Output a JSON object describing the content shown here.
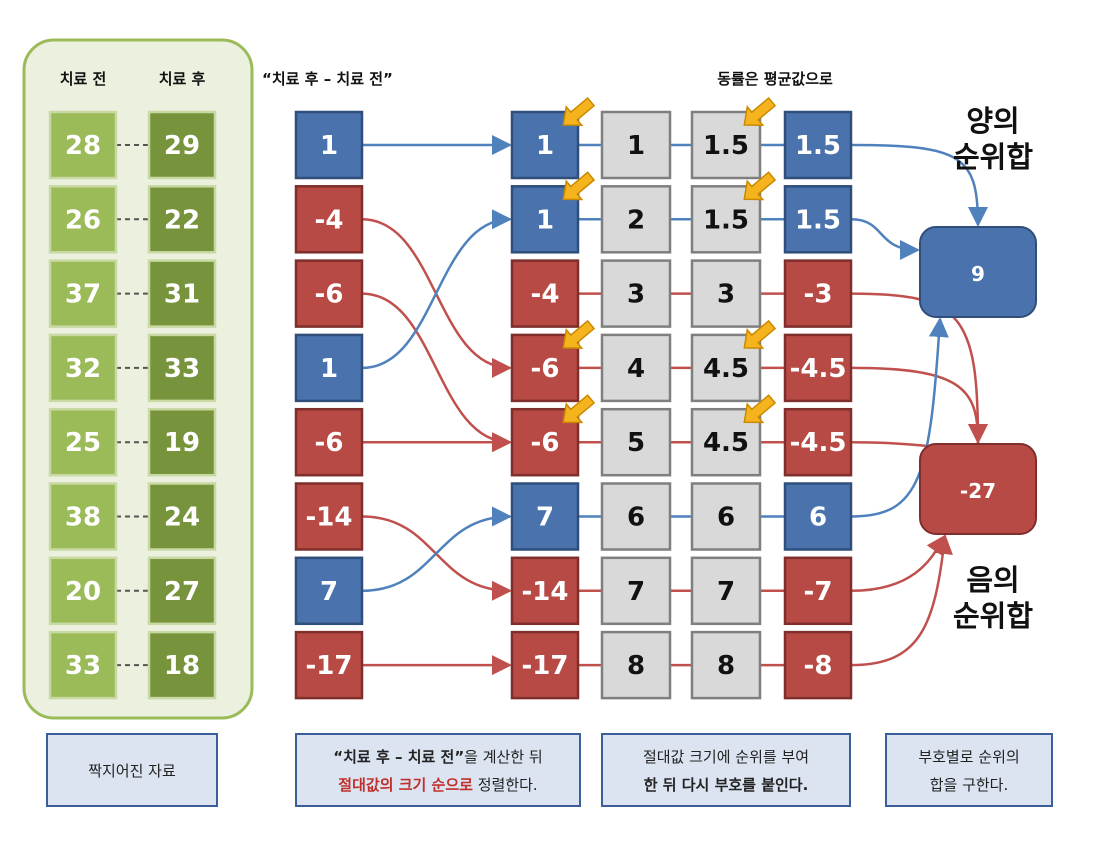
{
  "headers": {
    "before": "치료 전",
    "after": "치료 후",
    "difference": "“치료 후 – 치료 전”",
    "ties": "동률은 평균값으로"
  },
  "pairs": [
    {
      "before": "28",
      "after": "29"
    },
    {
      "before": "26",
      "after": "22"
    },
    {
      "before": "37",
      "after": "31"
    },
    {
      "before": "32",
      "after": "33"
    },
    {
      "before": "25",
      "after": "19"
    },
    {
      "before": "38",
      "after": "24"
    },
    {
      "before": "20",
      "after": "27"
    },
    {
      "before": "33",
      "after": "18"
    }
  ],
  "differences": [
    {
      "value": "1",
      "sign": "positive"
    },
    {
      "value": "-4",
      "sign": "negative"
    },
    {
      "value": "-6",
      "sign": "negative"
    },
    {
      "value": "1",
      "sign": "positive"
    },
    {
      "value": "-6",
      "sign": "negative"
    },
    {
      "value": "-14",
      "sign": "negative"
    },
    {
      "value": "7",
      "sign": "positive"
    },
    {
      "value": "-17",
      "sign": "negative"
    }
  ],
  "sorted": [
    {
      "value": "1",
      "sign": "positive",
      "rank": "1",
      "avg_rank": "1.5",
      "signed_rank": "1.5",
      "tie": true
    },
    {
      "value": "1",
      "sign": "positive",
      "rank": "2",
      "avg_rank": "1.5",
      "signed_rank": "1.5",
      "tie": true
    },
    {
      "value": "-4",
      "sign": "negative",
      "rank": "3",
      "avg_rank": "3",
      "signed_rank": "-3",
      "tie": false
    },
    {
      "value": "-6",
      "sign": "negative",
      "rank": "4",
      "avg_rank": "4.5",
      "signed_rank": "-4.5",
      "tie": true
    },
    {
      "value": "-6",
      "sign": "negative",
      "rank": "5",
      "avg_rank": "4.5",
      "signed_rank": "-4.5",
      "tie": true
    },
    {
      "value": "7",
      "sign": "positive",
      "rank": "6",
      "avg_rank": "6",
      "signed_rank": "6",
      "tie": false
    },
    {
      "value": "-14",
      "sign": "negative",
      "rank": "7",
      "avg_rank": "7",
      "signed_rank": "-7",
      "tie": false
    },
    {
      "value": "-17",
      "sign": "negative",
      "rank": "8",
      "avg_rank": "8",
      "signed_rank": "-8",
      "tie": false
    }
  ],
  "difference_to_sorted": [
    0,
    3,
    4,
    1,
    4,
    6,
    5,
    7
  ],
  "sums": {
    "positive": {
      "value": "9",
      "label_line1": "양의",
      "label_line2": "순위합"
    },
    "negative": {
      "value": "-27",
      "label_line1": "음의",
      "label_line2": "순위합"
    }
  },
  "captions": {
    "paired": "짝지어진 자료",
    "step2_part1": "“치료 후 – 치료 전”",
    "step2_part2": "을 계산한 뒤",
    "step2_part3": "절대값의 크기 순으로",
    "step2_part4": " 정렬한다.",
    "step3_line1": "절대값 크기에 순위를 부여",
    "step3_line2": "한 뒤 다시 부호를 붙인다.",
    "step4_line1": "부호별로 순위의",
    "step4_line2": "합을 구한다."
  },
  "colors": {
    "positive": "#4a72ad",
    "negative": "#b84a45",
    "green_light": "#9bbb59",
    "green_dark": "#77933c",
    "gray": "#d9d9d9",
    "panel": "#ebf1de",
    "caption_bg": "#dce4f2",
    "arrow_blue": "#4f81bd",
    "arrow_red": "#c0504d",
    "pointer": "#f5b41e"
  }
}
